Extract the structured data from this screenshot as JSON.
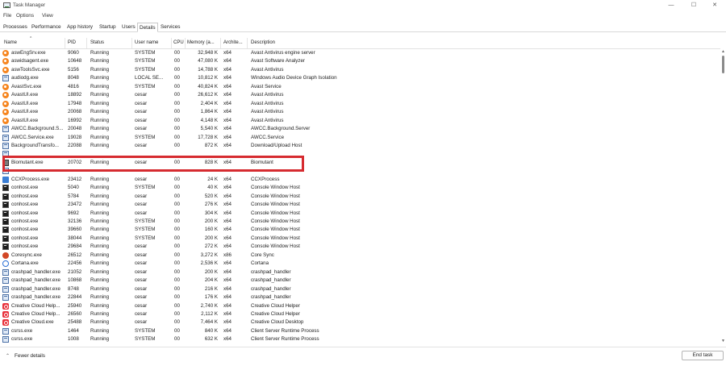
{
  "window": {
    "title": "Task Manager",
    "minimize_glyph": "—",
    "maximize_glyph": "☐",
    "close_glyph": "✕"
  },
  "menu": [
    "File",
    "Options",
    "View"
  ],
  "tabs": [
    {
      "label": "Processes",
      "active": false
    },
    {
      "label": "Performance",
      "active": false
    },
    {
      "label": "App history",
      "active": false
    },
    {
      "label": "Startup",
      "active": false
    },
    {
      "label": "Users",
      "active": false
    },
    {
      "label": "Details",
      "active": true
    },
    {
      "label": "Services",
      "active": false
    }
  ],
  "columns": {
    "name": "Name",
    "pid": "PID",
    "status": "Status",
    "user": "User name",
    "cpu": "CPU",
    "memory": "Memory (a...",
    "arch": "Archite...",
    "desc": "Description",
    "sort_glyph": "^"
  },
  "rows": [
    {
      "icon": "avast-icon",
      "name": "aswEngSrv.exe",
      "pid": "9060",
      "status": "Running",
      "user": "SYSTEM",
      "cpu": "00",
      "mem": "32,948 K",
      "arch": "x64",
      "desc": "Avast Antivirus engine server"
    },
    {
      "icon": "avast-icon",
      "name": "aswidsagent.exe",
      "pid": "10648",
      "status": "Running",
      "user": "SYSTEM",
      "cpu": "00",
      "mem": "47,080 K",
      "arch": "x64",
      "desc": "Avast Software Analyzer"
    },
    {
      "icon": "avast-icon",
      "name": "aswToolsSvc.exe",
      "pid": "5156",
      "status": "Running",
      "user": "SYSTEM",
      "cpu": "00",
      "mem": "14,788 K",
      "arch": "x64",
      "desc": "Avast Antivirus"
    },
    {
      "icon": "window-icon",
      "name": "audiodg.exe",
      "pid": "8048",
      "status": "Running",
      "user": "LOCAL SE...",
      "cpu": "00",
      "mem": "10,812 K",
      "arch": "x64",
      "desc": "Windows Audio Device Graph Isolation"
    },
    {
      "icon": "avast-icon",
      "name": "AvastSvc.exe",
      "pid": "4816",
      "status": "Running",
      "user": "SYSTEM",
      "cpu": "00",
      "mem": "40,824 K",
      "arch": "x64",
      "desc": "Avast Service"
    },
    {
      "icon": "avast-icon",
      "name": "AvastUI.exe",
      "pid": "18892",
      "status": "Running",
      "user": "cesar",
      "cpu": "00",
      "mem": "26,612 K",
      "arch": "x64",
      "desc": "Avast Antivirus"
    },
    {
      "icon": "avast-icon",
      "name": "AvastUI.exe",
      "pid": "17948",
      "status": "Running",
      "user": "cesar",
      "cpu": "00",
      "mem": "2,404 K",
      "arch": "x64",
      "desc": "Avast Antivirus"
    },
    {
      "icon": "avast-icon",
      "name": "AvastUI.exe",
      "pid": "20068",
      "status": "Running",
      "user": "cesar",
      "cpu": "00",
      "mem": "1,864 K",
      "arch": "x64",
      "desc": "Avast Antivirus"
    },
    {
      "icon": "avast-icon",
      "name": "AvastUI.exe",
      "pid": "16992",
      "status": "Running",
      "user": "cesar",
      "cpu": "00",
      "mem": "4,148 K",
      "arch": "x64",
      "desc": "Avast Antivirus"
    },
    {
      "icon": "window-icon",
      "name": "AWCC.Background.S...",
      "pid": "20048",
      "status": "Running",
      "user": "cesar",
      "cpu": "00",
      "mem": "5,540 K",
      "arch": "x64",
      "desc": "AWCC.Background.Server"
    },
    {
      "icon": "window-icon",
      "name": "AWCC.Service.exe",
      "pid": "19028",
      "status": "Running",
      "user": "SYSTEM",
      "cpu": "00",
      "mem": "17,728 K",
      "arch": "x64",
      "desc": "AWCC.Service"
    },
    {
      "icon": "window-icon",
      "name": "BackgroundTransfo...",
      "pid": "22088",
      "status": "Running",
      "user": "cesar",
      "cpu": "00",
      "mem": "872 K",
      "arch": "x64",
      "desc": "Download/Upload Host"
    },
    {
      "icon": "window-icon",
      "name": "",
      "pid": "",
      "status": "",
      "user": "",
      "cpu": "",
      "mem": "",
      "arch": "",
      "desc": ""
    },
    {
      "icon": "biomutant-icon",
      "name": "Biomutant.exe",
      "pid": "20702",
      "status": "Running",
      "user": "cesar",
      "cpu": "00",
      "mem": "828 K",
      "arch": "x64",
      "desc": "Biomutant"
    },
    {
      "icon": "window-icon",
      "name": "",
      "pid": "",
      "status": "",
      "user": "",
      "cpu": "",
      "mem": "",
      "arch": "",
      "desc": ""
    },
    {
      "icon": "ccx-icon",
      "name": "CCXProcess.exe",
      "pid": "23412",
      "status": "Running",
      "user": "cesar",
      "cpu": "00",
      "mem": "24 K",
      "arch": "x64",
      "desc": "CCXProcess"
    },
    {
      "icon": "console-icon",
      "name": "conhost.exe",
      "pid": "5040",
      "status": "Running",
      "user": "SYSTEM",
      "cpu": "00",
      "mem": "40 K",
      "arch": "x64",
      "desc": "Console Window Host"
    },
    {
      "icon": "console-icon",
      "name": "conhost.exe",
      "pid": "5784",
      "status": "Running",
      "user": "cesar",
      "cpu": "00",
      "mem": "520 K",
      "arch": "x64",
      "desc": "Console Window Host"
    },
    {
      "icon": "console-icon",
      "name": "conhost.exe",
      "pid": "23472",
      "status": "Running",
      "user": "cesar",
      "cpu": "00",
      "mem": "276 K",
      "arch": "x64",
      "desc": "Console Window Host"
    },
    {
      "icon": "console-icon",
      "name": "conhost.exe",
      "pid": "9692",
      "status": "Running",
      "user": "cesar",
      "cpu": "00",
      "mem": "304 K",
      "arch": "x64",
      "desc": "Console Window Host"
    },
    {
      "icon": "console-icon",
      "name": "conhost.exe",
      "pid": "32136",
      "status": "Running",
      "user": "SYSTEM",
      "cpu": "00",
      "mem": "200 K",
      "arch": "x64",
      "desc": "Console Window Host"
    },
    {
      "icon": "console-icon",
      "name": "conhost.exe",
      "pid": "39660",
      "status": "Running",
      "user": "SYSTEM",
      "cpu": "00",
      "mem": "160 K",
      "arch": "x64",
      "desc": "Console Window Host"
    },
    {
      "icon": "console-icon",
      "name": "conhost.exe",
      "pid": "38044",
      "status": "Running",
      "user": "SYSTEM",
      "cpu": "00",
      "mem": "200 K",
      "arch": "x64",
      "desc": "Console Window Host"
    },
    {
      "icon": "console-icon",
      "name": "conhost.exe",
      "pid": "29684",
      "status": "Running",
      "user": "cesar",
      "cpu": "00",
      "mem": "272 K",
      "arch": "x64",
      "desc": "Console Window Host"
    },
    {
      "icon": "coresync-icon",
      "name": "Coresync.exe",
      "pid": "26512",
      "status": "Running",
      "user": "cesar",
      "cpu": "00",
      "mem": "3,272 K",
      "arch": "x86",
      "desc": "Core Sync"
    },
    {
      "icon": "cortana-icon",
      "name": "Cortana.exe",
      "pid": "22456",
      "status": "Running",
      "user": "cesar",
      "cpu": "00",
      "mem": "2,536 K",
      "arch": "x64",
      "desc": "Cortana"
    },
    {
      "icon": "window-icon",
      "name": "crashpad_handler.exe",
      "pid": "21052",
      "status": "Running",
      "user": "cesar",
      "cpu": "00",
      "mem": "200 K",
      "arch": "x64",
      "desc": "crashpad_handler"
    },
    {
      "icon": "window-icon",
      "name": "crashpad_handler.exe",
      "pid": "10868",
      "status": "Running",
      "user": "cesar",
      "cpu": "00",
      "mem": "204 K",
      "arch": "x64",
      "desc": "crashpad_handler"
    },
    {
      "icon": "window-icon",
      "name": "crashpad_handler.exe",
      "pid": "8748",
      "status": "Running",
      "user": "cesar",
      "cpu": "00",
      "mem": "216 K",
      "arch": "x64",
      "desc": "crashpad_handler"
    },
    {
      "icon": "window-icon",
      "name": "crashpad_handler.exe",
      "pid": "22844",
      "status": "Running",
      "user": "cesar",
      "cpu": "00",
      "mem": "176 K",
      "arch": "x64",
      "desc": "crashpad_handler"
    },
    {
      "icon": "creative-cloud-icon",
      "name": "Creative Cloud Help...",
      "pid": "25940",
      "status": "Running",
      "user": "cesar",
      "cpu": "00",
      "mem": "2,740 K",
      "arch": "x64",
      "desc": "Creative Cloud Helper"
    },
    {
      "icon": "creative-cloud-icon",
      "name": "Creative Cloud Help...",
      "pid": "26560",
      "status": "Running",
      "user": "cesar",
      "cpu": "00",
      "mem": "2,112 K",
      "arch": "x64",
      "desc": "Creative Cloud Helper"
    },
    {
      "icon": "creative-cloud-icon",
      "name": "Creative Cloud.exe",
      "pid": "25488",
      "status": "Running",
      "user": "cesar",
      "cpu": "00",
      "mem": "7,464 K",
      "arch": "x64",
      "desc": "Creative Cloud Desktop"
    },
    {
      "icon": "window-icon",
      "name": "csrss.exe",
      "pid": "1464",
      "status": "Running",
      "user": "SYSTEM",
      "cpu": "00",
      "mem": "840 K",
      "arch": "x64",
      "desc": "Client Server Runtime Process"
    },
    {
      "icon": "window-icon",
      "name": "csrss.exe",
      "pid": "1008",
      "status": "Running",
      "user": "SYSTEM",
      "cpu": "00",
      "mem": "632 K",
      "arch": "x64",
      "desc": "Client Server Runtime Process"
    }
  ],
  "footer": {
    "fewer_details_label": "Fewer details",
    "fewer_details_glyph": "⌃",
    "end_task_label": "End task"
  },
  "scrollbar": {
    "up_glyph": "▲",
    "down_glyph": "▼"
  }
}
